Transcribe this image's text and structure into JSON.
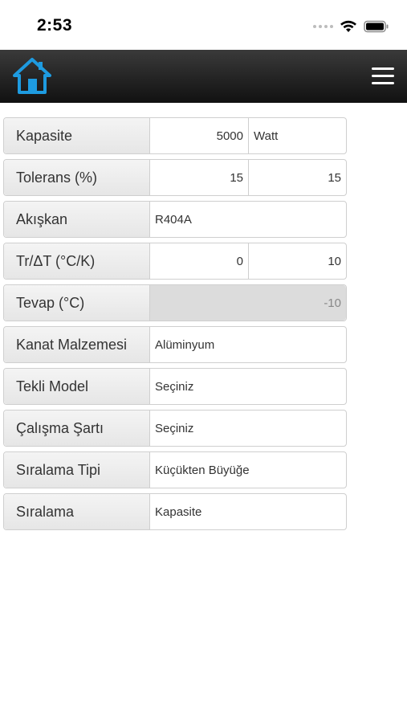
{
  "status": {
    "time": "2:53"
  },
  "nav": {
    "home_icon": "home-icon",
    "menu_icon": "hamburger-menu-icon"
  },
  "form": {
    "kapasite": {
      "label": "Kapasite",
      "value": "5000",
      "unit": "Watt"
    },
    "tolerans": {
      "label": "Tolerans (%)",
      "min": "15",
      "max": "15"
    },
    "akiskan": {
      "label": "Akışkan",
      "value": "R404A"
    },
    "tr_dt": {
      "label": "Tr/ΔT (°C/K)",
      "tr": "0",
      "dt": "10"
    },
    "tevap": {
      "label": "Tevap (°C)",
      "value": "-10"
    },
    "kanat": {
      "label": "Kanat Malzemesi",
      "value": "Alüminyum"
    },
    "tekli_model": {
      "label": "Tekli Model",
      "value": "Seçiniz"
    },
    "calisma_sarti": {
      "label": "Çalışma Şartı",
      "value": "Seçiniz"
    },
    "siralama_tipi": {
      "label": "Sıralama Tipi",
      "value": "Küçükten Büyüğe"
    },
    "siralama": {
      "label": "Sıralama",
      "value": "Kapasite"
    }
  },
  "colors": {
    "accent": "#1e9be0",
    "navbar": "#1a1a1a",
    "disabled_field": "#dcdcdc"
  }
}
